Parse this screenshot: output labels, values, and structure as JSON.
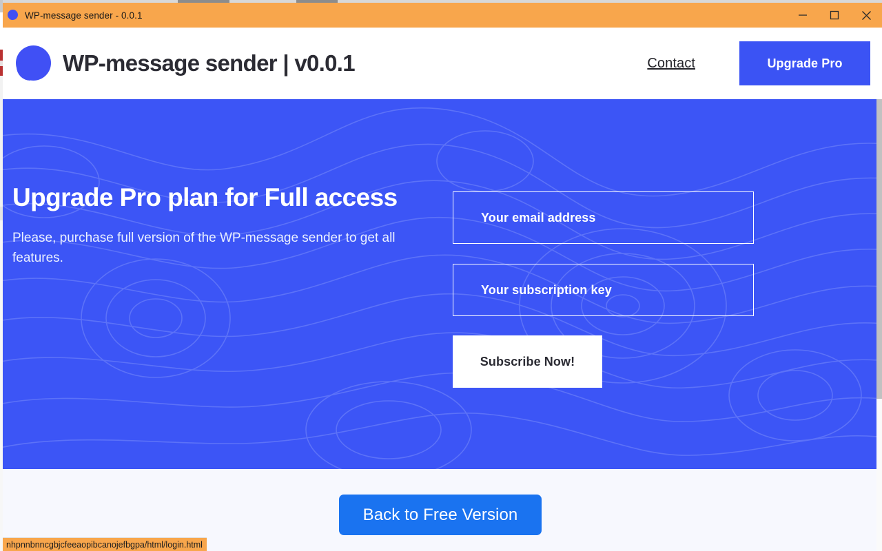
{
  "window": {
    "title": "WP-message sender - 0.0.1",
    "icon": "speech-bubble-icon",
    "controls": {
      "minimize": "minimize-icon",
      "maximize": "maximize-icon",
      "close": "close-icon"
    },
    "titlebar_color": "#F8A64C"
  },
  "header": {
    "logo_icon": "speech-bubble-icon",
    "brand_title": "WP-message sender | v0.0.1",
    "nav": {
      "contact_label": "Contact",
      "upgrade_label": "Upgrade Pro",
      "upgrade_color": "#3B53F4"
    }
  },
  "hero": {
    "background_color": "#3C55F6",
    "heading": "Upgrade Pro plan for Full access",
    "subtext": "Please, purchase full version of the WP-message sender to get all features.",
    "form": {
      "email_placeholder": "Your email address",
      "email_value": "",
      "key_placeholder": "Your subscription key",
      "key_value": "",
      "submit_label": "Subscribe Now!"
    }
  },
  "footer": {
    "background_color": "#F7F8FE",
    "back_button_label": "Back to Free Version",
    "back_button_color": "#1A73F0"
  },
  "status_bar": {
    "url": "nhpnnbnncgbjcfeeaopibcanojefbgpa/html/login.html",
    "background_color": "#F8A64C"
  }
}
